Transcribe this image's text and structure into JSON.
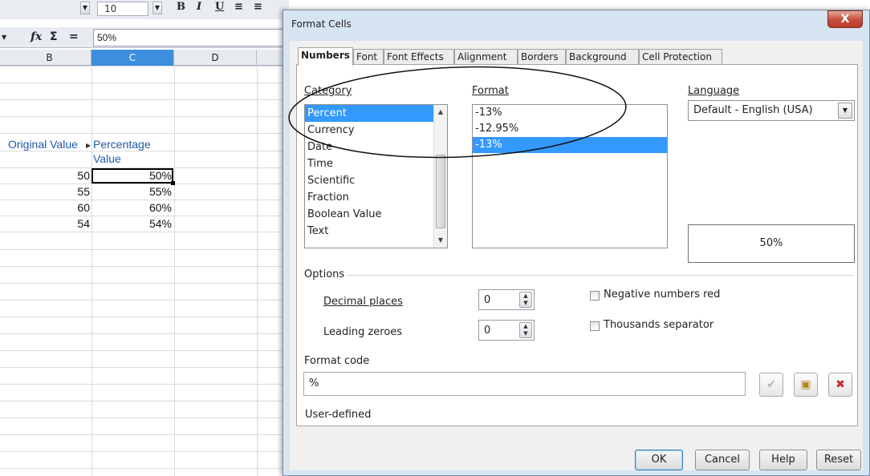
{
  "toolbar": {
    "font_size": "10"
  },
  "formula_bar": {
    "value": "50%"
  },
  "sheet": {
    "columns": [
      {
        "label": "B",
        "selected": false
      },
      {
        "label": "C",
        "selected": true
      },
      {
        "label": "D",
        "selected": false
      }
    ],
    "header_b": "Original Value",
    "header_c_line1": "Percentage",
    "header_c_line2": "Value",
    "rows": [
      {
        "b": "50",
        "c": "50%"
      },
      {
        "b": "55",
        "c": "55%"
      },
      {
        "b": "60",
        "c": "60%"
      },
      {
        "b": "54",
        "c": "54%"
      }
    ]
  },
  "dialog": {
    "title": "Format Cells",
    "close_label": "X",
    "tabs": [
      "Numbers",
      "Font",
      "Font Effects",
      "Alignment",
      "Borders",
      "Background",
      "Cell Protection"
    ],
    "active_tab": "Numbers",
    "category": {
      "label": "Category",
      "items": [
        "Percent",
        "Currency",
        "Date",
        "Time",
        "Scientific",
        "Fraction",
        "Boolean Value",
        "Text"
      ],
      "selected": "Percent"
    },
    "format": {
      "label": "Format",
      "items": [
        "-13%",
        "-12.95%",
        "-13%"
      ],
      "selected_index": 2
    },
    "language": {
      "label": "Language",
      "value": "Default - English (USA)"
    },
    "preview": "50%",
    "options": {
      "label": "Options",
      "decimal_places_label": "Decimal places",
      "decimal_places_value": "0",
      "leading_zeroes_label": "Leading zeroes",
      "leading_zeroes_value": "0",
      "negative_red_label": "Negative numbers red",
      "negative_red_checked": false,
      "thousands_sep_label": "Thousands separator",
      "thousands_sep_checked": false
    },
    "format_code": {
      "label": "Format code",
      "value": "%",
      "status": "User-defined"
    },
    "buttons": {
      "ok": "OK",
      "cancel": "Cancel",
      "help": "Help",
      "reset": "Reset"
    }
  },
  "colors": {
    "selection": "#3399ff",
    "column_selected": "#3b8fdc",
    "header_text": "#1f5aa8",
    "close_button": "#c75240",
    "delete_icon": "#cc2a2a"
  },
  "icons": [
    "function-wizard-icon",
    "sum-icon",
    "equals-icon",
    "accept-icon",
    "edit-comment-icon",
    "delete-icon",
    "spin-arrows-icon",
    "dropdown-arrow-icon"
  ]
}
